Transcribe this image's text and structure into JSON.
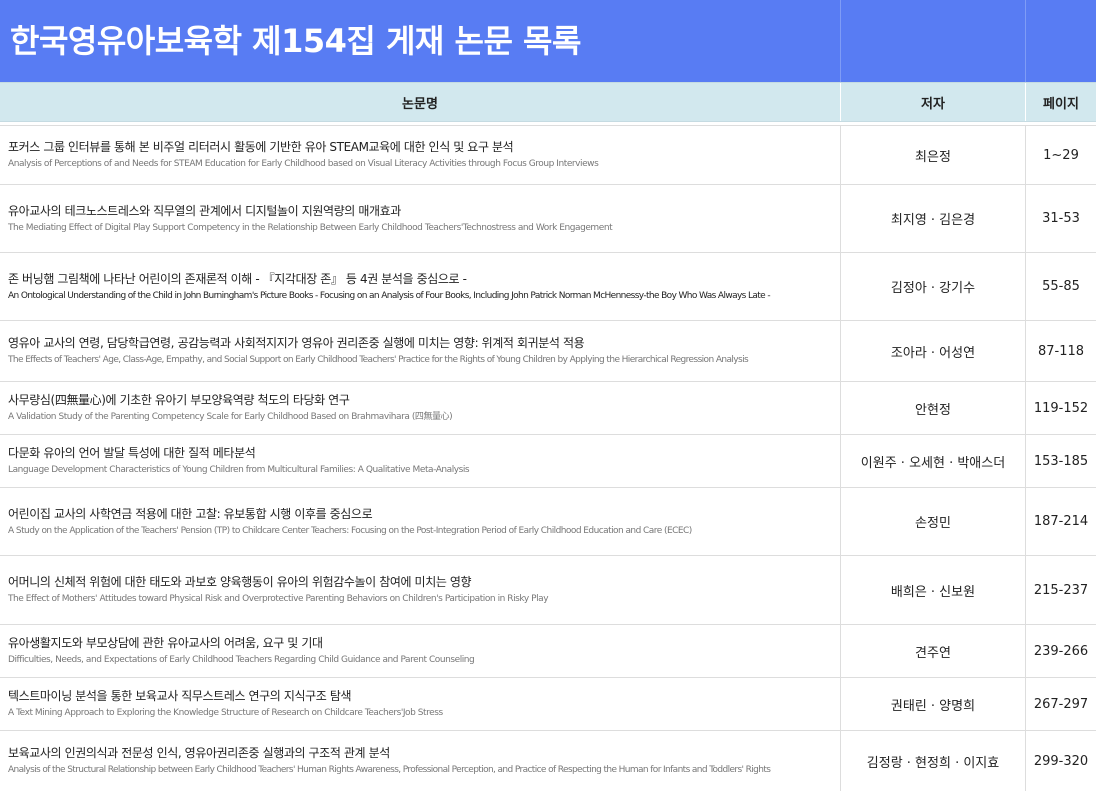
{
  "page_title": "한국영유아보육학 제154집 게재 논문 목록",
  "headers": {
    "title": "논문명",
    "author": "저자",
    "page": "페이지"
  },
  "papers": [
    {
      "ko": "포커스 그룹 인터뷰를 통해 본 비주얼 리터러시 활동에 기반한  유아 STEAM교육에 대한 인식 및 요구 분석",
      "en": "Analysis of Perceptions of and Needs for STEAM Education for Early Childhood based on Visual Literacy Activities through Focus Group Interviews",
      "author": "최은정",
      "pages": "1~29"
    },
    {
      "ko": "유아교사의 테크노스트레스와 직무열의 관계에서 디지털놀이 지원역량의 매개효과",
      "en": "The Mediating Effect of Digital Play Support Competency in the Relationship Between Early Childhood Teachers'Technostress and Work Engagement",
      "author": "최지영 · 김은경",
      "pages": "31-53"
    },
    {
      "ko": "존 버닝햄 그림책에 나타난 어린이의 존재론적 이해 - 『지각대장 존』 등 4권 분석을 중심으로 -",
      "en": "An Ontological Understanding of the Child in John Burningham's Picture Books - Focusing on an Analysis of Four Books, Including John Patrick Norman McHennessy-the Boy Who Was Always Late -",
      "author": "김정아 · 강기수",
      "pages": "55-85"
    },
    {
      "ko": "영유아 교사의 연령, 담당학급연령, 공감능력과 사회적지지가 영유아 권리존중 실행에 미치는 영향: 위계적 회귀분석 적용",
      "en": "The Effects of Teachers' Age, Class-Age, Empathy, and Social Support on Early Childhood Teachers' Practice for the Rights of Young Children by Applying the Hierarchical Regression Analysis",
      "author": "조아라 · 어성연",
      "pages": "87-118"
    },
    {
      "ko": "사무량심(四無量心)에 기초한 유아기 부모양육역량 척도의 타당화 연구",
      "en": "A Validation Study of the Parenting Competency Scale for Early Childhood Based on Brahmavihara (四無量心)",
      "author": "안현정",
      "pages": "119-152"
    },
    {
      "ko": "다문화 유아의 언어 발달 특성에 대한 질적 메타분석",
      "en": "Language Development Characteristics of Young Children from Multicultural Families: A Qualitative Meta-Analysis",
      "author": "이원주 · 오세현 · 박애스더",
      "pages": "153-185"
    },
    {
      "ko": "어린이집 교사의 사학연금 적용에 대한 고찰: 유보통합 시행 이후를 중심으로",
      "en": "A Study on the Application of the Teachers' Pension (TP) to Childcare Center Teachers: Focusing on the Post-Integration Period of Early Childhood Education and Care (ECEC)",
      "author": "손정민",
      "pages": "187-214"
    },
    {
      "ko": "어머니의 신체적 위험에 대한 태도와 과보호 양육행동이 유아의 위험감수놀이 참여에 미치는 영향",
      "en": "The Effect of Mothers' Attitudes toward Physical Risk and Overprotective Parenting Behaviors on Children's Participation in Risky Play",
      "author": "배희은 · 신보원",
      "pages": "215-237"
    },
    {
      "ko": "유아생활지도와 부모상담에 관한 유아교사의 어려움, 요구 및 기대",
      "en": "Difficulties, Needs, and Expectations of Early Childhood Teachers Regarding Child Guidance and Parent Counseling",
      "author": "견주연",
      "pages": "239-266"
    },
    {
      "ko": "텍스트마이닝 분석을 통한 보육교사 직무스트레스 연구의 지식구조 탐색",
      "en": "A Text Mining Approach to Exploring the Knowledge Structure of Research on Childcare Teachers'Job Stress",
      "author": "권태린 · 양명희",
      "pages": "267-297"
    },
    {
      "ko": "보육교사의 인권의식과 전문성 인식, 영유아권리존중 실행과의 구조적 관계 분석",
      "en": "Analysis of the Structural Relationship between Early Childhood Teachers' Human Rights Awareness, Professional Perception, and Practice of Respecting the Human for Infants and Toddlers' Rights",
      "author": "김정랑 · 현정희 · 이지효",
      "pages": "299-320"
    }
  ]
}
